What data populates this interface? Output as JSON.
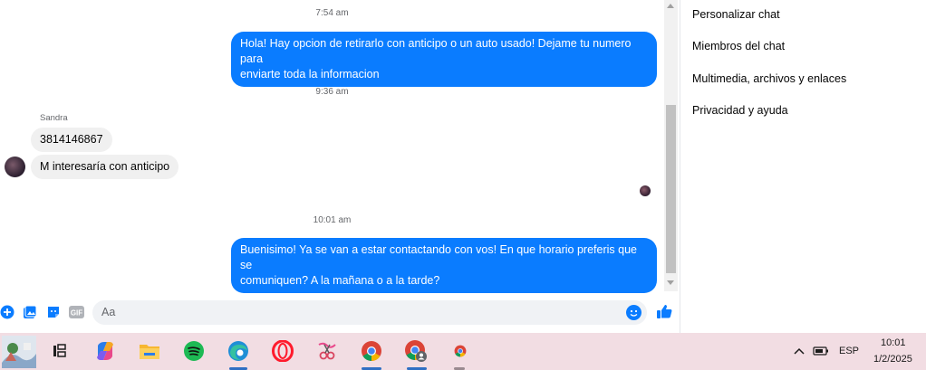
{
  "messages": {
    "t1": "7:54 am",
    "m1_line1": "Hola! Hay opcion de retirarlo con anticipo o un auto usado! Dejame tu numero para",
    "m1_line2": "enviarte toda la informacion",
    "t2": "9:36 am",
    "sender": "Sandra",
    "m2": "3814146867",
    "m3": "M interesaría con anticipo",
    "t3": "10:01 am",
    "m4_line1": "Buenisimo! Ya se van a estar contactando con vos! En que horario preferis que se",
    "m4_line2": "comuniquen? A la mañana o a la tarde?"
  },
  "panel": {
    "items": [
      "Personalizar chat",
      "Miembros del chat",
      "Multimedia, archivos y enlaces",
      "Privacidad y ayuda"
    ]
  },
  "composer": {
    "placeholder": "Aa",
    "gif_label": "GIF"
  },
  "taskbar": {
    "language": "ESP",
    "time": "10:01",
    "date": "1/2/2025"
  },
  "colors": {
    "accent": "#0a7cff",
    "incoming_bubble": "#f0f0f0",
    "taskbar": "#f2dde3"
  }
}
